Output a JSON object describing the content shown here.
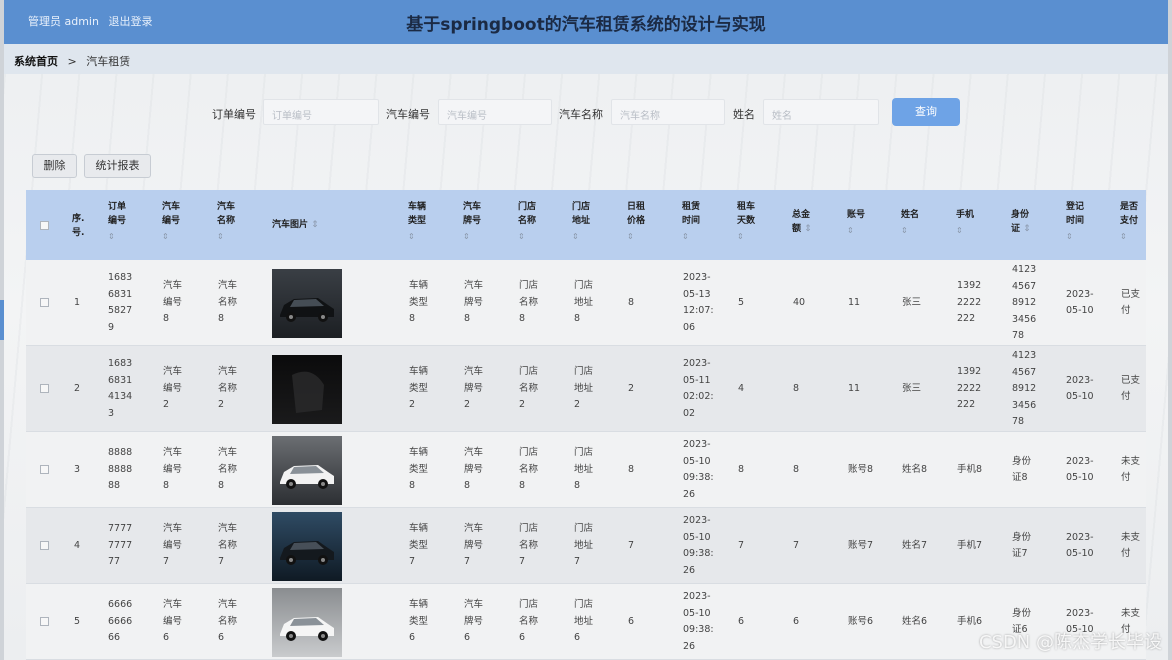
{
  "header": {
    "user_label": "管理员 admin",
    "logout": "退出登录",
    "title": "基于springboot的汽车租赁系统的设计与实现"
  },
  "breadcrumb": {
    "home": "系统首页",
    "separator": ">",
    "current": "汽车租赁"
  },
  "search": {
    "fields": [
      {
        "label": "订单编号",
        "placeholder": "订单编号"
      },
      {
        "label": "汽车编号",
        "placeholder": "汽车编号"
      },
      {
        "label": "汽车名称",
        "placeholder": "汽车名称"
      },
      {
        "label": "姓名",
        "placeholder": "姓名"
      }
    ],
    "query_button": "查询"
  },
  "actions": {
    "delete": "删除",
    "report": "统计报表"
  },
  "table": {
    "headers": [
      "序号",
      "订单编号",
      "汽车编号",
      "汽车名称",
      "汽车图片",
      "车辆类型",
      "汽车牌号",
      "门店名称",
      "门店地址",
      "日租价格",
      "租赁时间",
      "租车天数",
      "总金额",
      "账号",
      "姓名",
      "手机",
      "身份证",
      "登记时间",
      "是否支付"
    ],
    "rows": [
      {
        "no": "1",
        "order": "1683683158279",
        "car_no": "汽车编号8",
        "car_name": "汽车名称8",
        "img": "dark-suv",
        "type": "车辆类型8",
        "plate": "汽车牌号8",
        "store": "门店名称8",
        "addr": "门店地址8",
        "price": "8",
        "time": "2023-05-13 12:07:06",
        "days": "5",
        "total": "40",
        "account": "11",
        "name": "张三",
        "phone": "13922222222",
        "id": "412345678912345678",
        "reg": "2023-05-10",
        "paid": "已支付"
      },
      {
        "no": "2",
        "order": "1683683141343",
        "car_no": "汽车编号2",
        "car_name": "汽车名称2",
        "img": "black",
        "type": "车辆类型2",
        "plate": "汽车牌号2",
        "store": "门店名称2",
        "addr": "门店地址2",
        "price": "2",
        "time": "2023-05-11 02:02:02",
        "days": "4",
        "total": "8",
        "account": "11",
        "name": "张三",
        "phone": "13922222222",
        "id": "412345678912345678",
        "reg": "2023-05-10",
        "paid": "已支付"
      },
      {
        "no": "3",
        "order": "8888888888",
        "car_no": "汽车编号8",
        "car_name": "汽车名称8",
        "img": "white-suv",
        "type": "车辆类型8",
        "plate": "汽车牌号8",
        "store": "门店名称8",
        "addr": "门店地址8",
        "price": "8",
        "time": "2023-05-10 09:38:26",
        "days": "8",
        "total": "8",
        "account": "账号8",
        "name": "姓名8",
        "phone": "手机8",
        "id": "身份证8",
        "reg": "2023-05-10",
        "paid": "未支付"
      },
      {
        "no": "4",
        "order": "7777777777",
        "car_no": "汽车编号7",
        "car_name": "汽车名称7",
        "img": "dark-blue",
        "type": "车辆类型7",
        "plate": "汽车牌号7",
        "store": "门店名称7",
        "addr": "门店地址7",
        "price": "7",
        "time": "2023-05-10 09:38:26",
        "days": "7",
        "total": "7",
        "account": "账号7",
        "name": "姓名7",
        "phone": "手机7",
        "id": "身份证7",
        "reg": "2023-05-10",
        "paid": "未支付"
      },
      {
        "no": "5",
        "order": "6666666666",
        "car_no": "汽车编号6",
        "car_name": "汽车名称6",
        "img": "white-car",
        "type": "车辆类型6",
        "plate": "汽车牌号6",
        "store": "门店名称6",
        "addr": "门店地址6",
        "price": "6",
        "time": "2023-05-10 09:38:26",
        "days": "6",
        "total": "6",
        "account": "账号6",
        "name": "姓名6",
        "phone": "手机6",
        "id": "身份证6",
        "reg": "2023-05-10",
        "paid": "未支付"
      }
    ]
  },
  "watermark": "CSDN @陈杰学长毕设",
  "colors": {
    "header": "#5a8fd0",
    "table_head": "#b9cfee",
    "query_button": "#6ea3e6"
  }
}
